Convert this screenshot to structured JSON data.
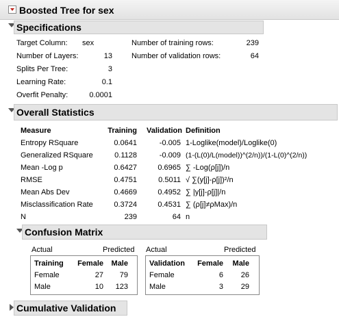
{
  "report": {
    "title": "Boosted Tree for sex"
  },
  "specifications": {
    "title": "Specifications",
    "left": [
      {
        "label": "Target Column:",
        "value": "sex"
      },
      {
        "label": "Number of Layers:",
        "value": "13"
      },
      {
        "label": "Splits Per Tree:",
        "value": "3"
      },
      {
        "label": "Learning Rate:",
        "value": "0.1"
      },
      {
        "label": "Overfit Penalty:",
        "value": "0.0001"
      }
    ],
    "right": [
      {
        "label": "Number of training rows:",
        "value": "239"
      },
      {
        "label": "Number of validation rows:",
        "value": "64"
      }
    ]
  },
  "overall": {
    "title": "Overall Statistics",
    "headers": [
      "Measure",
      "Training",
      "Validation",
      "Definition"
    ],
    "rows": [
      [
        "Entropy RSquare",
        "0.0641",
        "-0.005",
        "1-Loglike(model)/Loglike(0)"
      ],
      [
        "Generalized RSquare",
        "0.1128",
        "-0.009",
        "(1-(L(0)/L(model))^(2/n))/(1-L(0)^(2/n))"
      ],
      [
        "Mean -Log p",
        "0.6427",
        "0.6965",
        "∑ -Log(ρ[j])/n"
      ],
      [
        "RMSE",
        "0.4751",
        "0.5011",
        "√ ∑(y[j]-ρ[j])²/n"
      ],
      [
        "Mean Abs Dev",
        "0.4669",
        "0.4952",
        "∑ |y[j]-ρ[j]|/n"
      ],
      [
        "Misclassification Rate",
        "0.3724",
        "0.4531",
        "∑ (ρ[j]≠ρMax)/n"
      ],
      [
        "N",
        "239",
        "64",
        "n"
      ]
    ]
  },
  "confusion": {
    "title": "Confusion Matrix",
    "actual_label": "Actual",
    "predicted_label": "Predicted",
    "tables": [
      {
        "set": "Training",
        "cols": [
          "Female",
          "Male"
        ],
        "rows": [
          [
            "Female",
            "27",
            "79"
          ],
          [
            "Male",
            "10",
            "123"
          ]
        ]
      },
      {
        "set": "Validation",
        "cols": [
          "Female",
          "Male"
        ],
        "rows": [
          [
            "Female",
            "6",
            "26"
          ],
          [
            "Male",
            "3",
            "29"
          ]
        ]
      }
    ]
  },
  "cumulative": {
    "title": "Cumulative Validation"
  }
}
